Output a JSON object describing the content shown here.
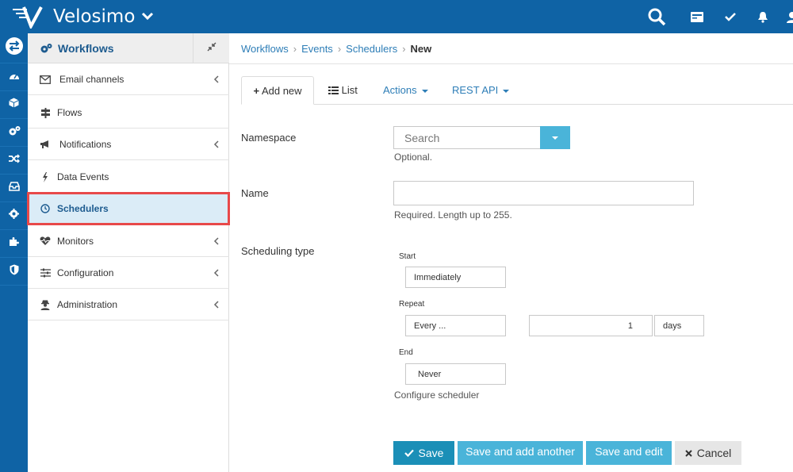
{
  "app": {
    "brand": "Velosimo"
  },
  "colors": {
    "primary": "#0f63a5",
    "accent": "#1b8fb7",
    "highlight": "#e8494a"
  },
  "topbar_icons": [
    "search-icon",
    "card-icon",
    "check-icon",
    "bell-icon",
    "user-icon"
  ],
  "rail_icons": [
    "exchange-icon",
    "dashboard-icon",
    "cube-icon",
    "cogs-icon",
    "random-icon",
    "inbox-icon",
    "gear-icon",
    "puzzle-icon",
    "shield-icon"
  ],
  "sidebar": {
    "title": "Workflows",
    "items": [
      {
        "label": "Email channels",
        "icon": "envelope-icon",
        "chevron": true
      },
      {
        "label": "Flows",
        "icon": "signpost-icon",
        "chevron": false
      },
      {
        "label": "Notifications",
        "icon": "bullhorn-icon",
        "chevron": true
      },
      {
        "label": "Data Events",
        "icon": "bolt-icon",
        "chevron": false
      },
      {
        "label": "Schedulers",
        "icon": "clock-icon",
        "chevron": false,
        "active": true
      },
      {
        "label": "Monitors",
        "icon": "heartbeat-icon",
        "chevron": true
      },
      {
        "label": "Configuration",
        "icon": "sliders-icon",
        "chevron": true
      },
      {
        "label": "Administration",
        "icon": "user-secret-icon",
        "chevron": true
      }
    ]
  },
  "breadcrumb": {
    "items": [
      "Workflows",
      "Events",
      "Schedulers"
    ],
    "current": "New"
  },
  "tabs": {
    "add_new": "Add new",
    "list": "List",
    "actions": "Actions",
    "rest_api": "REST API"
  },
  "form": {
    "namespace": {
      "label": "Namespace",
      "placeholder": "Search",
      "help": "Optional."
    },
    "name": {
      "label": "Name",
      "value": "",
      "help": "Required. Length up to 255."
    },
    "scheduling": {
      "label": "Scheduling type",
      "start_label": "Start",
      "start_value": "Immediately",
      "repeat_label": "Repeat",
      "repeat_value": "Every ...",
      "repeat_count": "1",
      "repeat_unit": "days",
      "end_label": "End",
      "end_value": "Never",
      "help": "Configure scheduler"
    }
  },
  "buttons": {
    "save": "Save",
    "save_add": "Save and add another",
    "save_edit": "Save and edit",
    "cancel": "Cancel"
  }
}
